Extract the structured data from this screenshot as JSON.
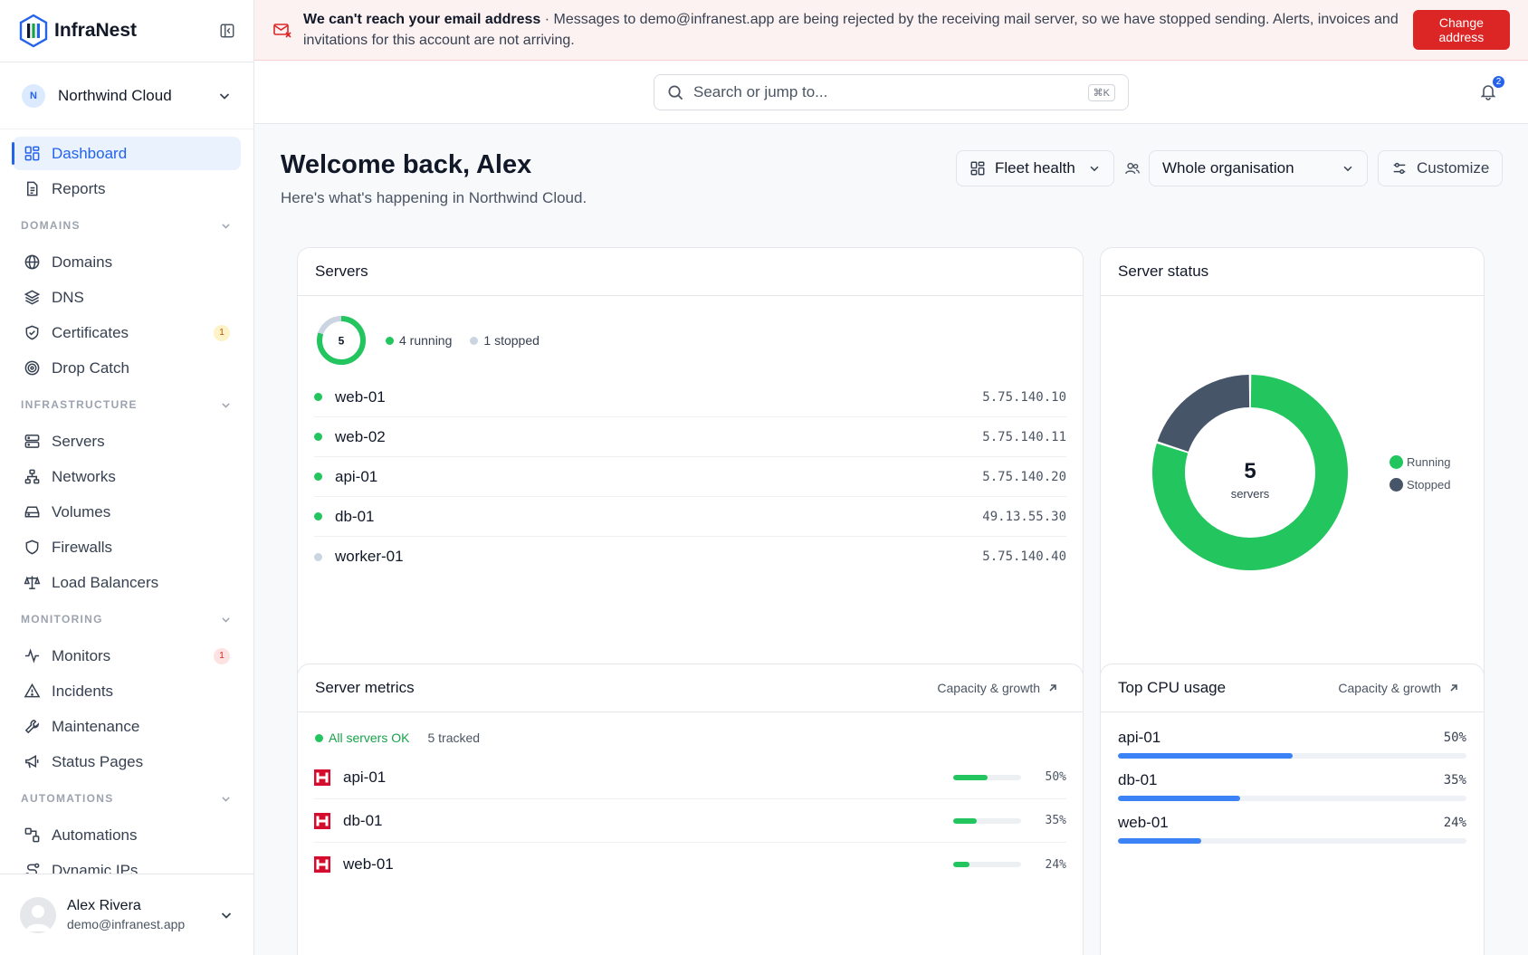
{
  "brand": {
    "name": "InfraNest"
  },
  "org": {
    "initial": "N",
    "name": "Northwind Cloud"
  },
  "nav": {
    "top": [
      {
        "label": "Dashboard",
        "icon": "dashboard-icon",
        "active": true
      },
      {
        "label": "Reports",
        "icon": "report-icon"
      }
    ],
    "domains": {
      "title": "DOMAINS",
      "items": [
        {
          "label": "Domains",
          "icon": "globe-icon"
        },
        {
          "label": "DNS",
          "icon": "layers-icon"
        },
        {
          "label": "Certificates",
          "icon": "shield-check-icon",
          "badge": "1"
        },
        {
          "label": "Drop Catch",
          "icon": "target-icon"
        }
      ]
    },
    "infrastructure": {
      "title": "INFRASTRUCTURE",
      "items": [
        {
          "label": "Servers",
          "icon": "server-icon"
        },
        {
          "label": "Networks",
          "icon": "network-icon"
        },
        {
          "label": "Volumes",
          "icon": "drive-icon"
        },
        {
          "label": "Firewalls",
          "icon": "shield-icon"
        },
        {
          "label": "Load Balancers",
          "icon": "scale-icon"
        }
      ]
    },
    "monitoring": {
      "title": "MONITORING",
      "items": [
        {
          "label": "Monitors",
          "icon": "pulse-icon",
          "badge": "1"
        },
        {
          "label": "Incidents",
          "icon": "warning-icon"
        },
        {
          "label": "Maintenance",
          "icon": "wrench-icon"
        },
        {
          "label": "Status Pages",
          "icon": "megaphone-icon"
        }
      ]
    },
    "automations": {
      "title": "AUTOMATIONS",
      "items": [
        {
          "label": "Automations",
          "icon": "workflow-icon"
        },
        {
          "label": "Dynamic IPs",
          "icon": "route-icon"
        }
      ]
    }
  },
  "user": {
    "name": "Alex Rivera",
    "email": "demo@infranest.app"
  },
  "alert": {
    "title": "We can't reach your email address",
    "sep": " · ",
    "message": "Messages to demo@infranest.app are being rejected by the receiving mail server, so we have stopped sending. Alerts, invoices and invitations for this account are not arriving.",
    "action": "Change address"
  },
  "search": {
    "placeholder": "Search or jump to...",
    "shortcut": "⌘K"
  },
  "notifications": {
    "count": "2"
  },
  "header": {
    "greeting": "Welcome back, Alex",
    "subtitle": "Here's what's happening in Northwind Cloud.",
    "view": "Fleet health",
    "scope": "Whole organisation",
    "customize": "Customize"
  },
  "servers_card": {
    "title": "Servers",
    "total": "5",
    "running_label": "4 running",
    "stopped_label": "1 stopped",
    "rows": [
      {
        "name": "web-01",
        "ip": "5.75.140.10",
        "status": "running"
      },
      {
        "name": "web-02",
        "ip": "5.75.140.11",
        "status": "running"
      },
      {
        "name": "api-01",
        "ip": "5.75.140.20",
        "status": "running"
      },
      {
        "name": "db-01",
        "ip": "49.13.55.30",
        "status": "running"
      },
      {
        "name": "worker-01",
        "ip": "5.75.140.40",
        "status": "stopped"
      }
    ]
  },
  "status_card": {
    "title": "Server status",
    "center_value": "5",
    "center_label": "servers",
    "legend": [
      {
        "label": "Running",
        "color": "#22c55e"
      },
      {
        "label": "Stopped",
        "color": "#475569"
      }
    ]
  },
  "chart_data": {
    "type": "pie",
    "categories": [
      "Running",
      "Stopped"
    ],
    "values": [
      4,
      1
    ],
    "colors": [
      "#22c55e",
      "#475569"
    ]
  },
  "metrics_card": {
    "title": "Server metrics",
    "link": "Capacity & growth",
    "status": "All servers OK",
    "tracked": "5 tracked",
    "rows": [
      {
        "name": "api-01",
        "value": 0.5,
        "pct": "50%"
      },
      {
        "name": "db-01",
        "value": 0.35,
        "pct": "35%"
      },
      {
        "name": "web-01",
        "value": 0.24,
        "pct": "24%"
      }
    ]
  },
  "cpu_card": {
    "title": "Top CPU usage",
    "link": "Capacity & growth",
    "rows": [
      {
        "name": "api-01",
        "value": 0.5,
        "pct": "50%"
      },
      {
        "name": "db-01",
        "value": 0.35,
        "pct": "35%"
      },
      {
        "name": "web-01",
        "value": 0.24,
        "pct": "24%"
      }
    ]
  },
  "colors": {
    "accent": "#2563eb",
    "running": "#22c55e",
    "stopped": "#cbd5e1",
    "danger": "#dc2626",
    "cpu_bar": "#3b82f6"
  }
}
